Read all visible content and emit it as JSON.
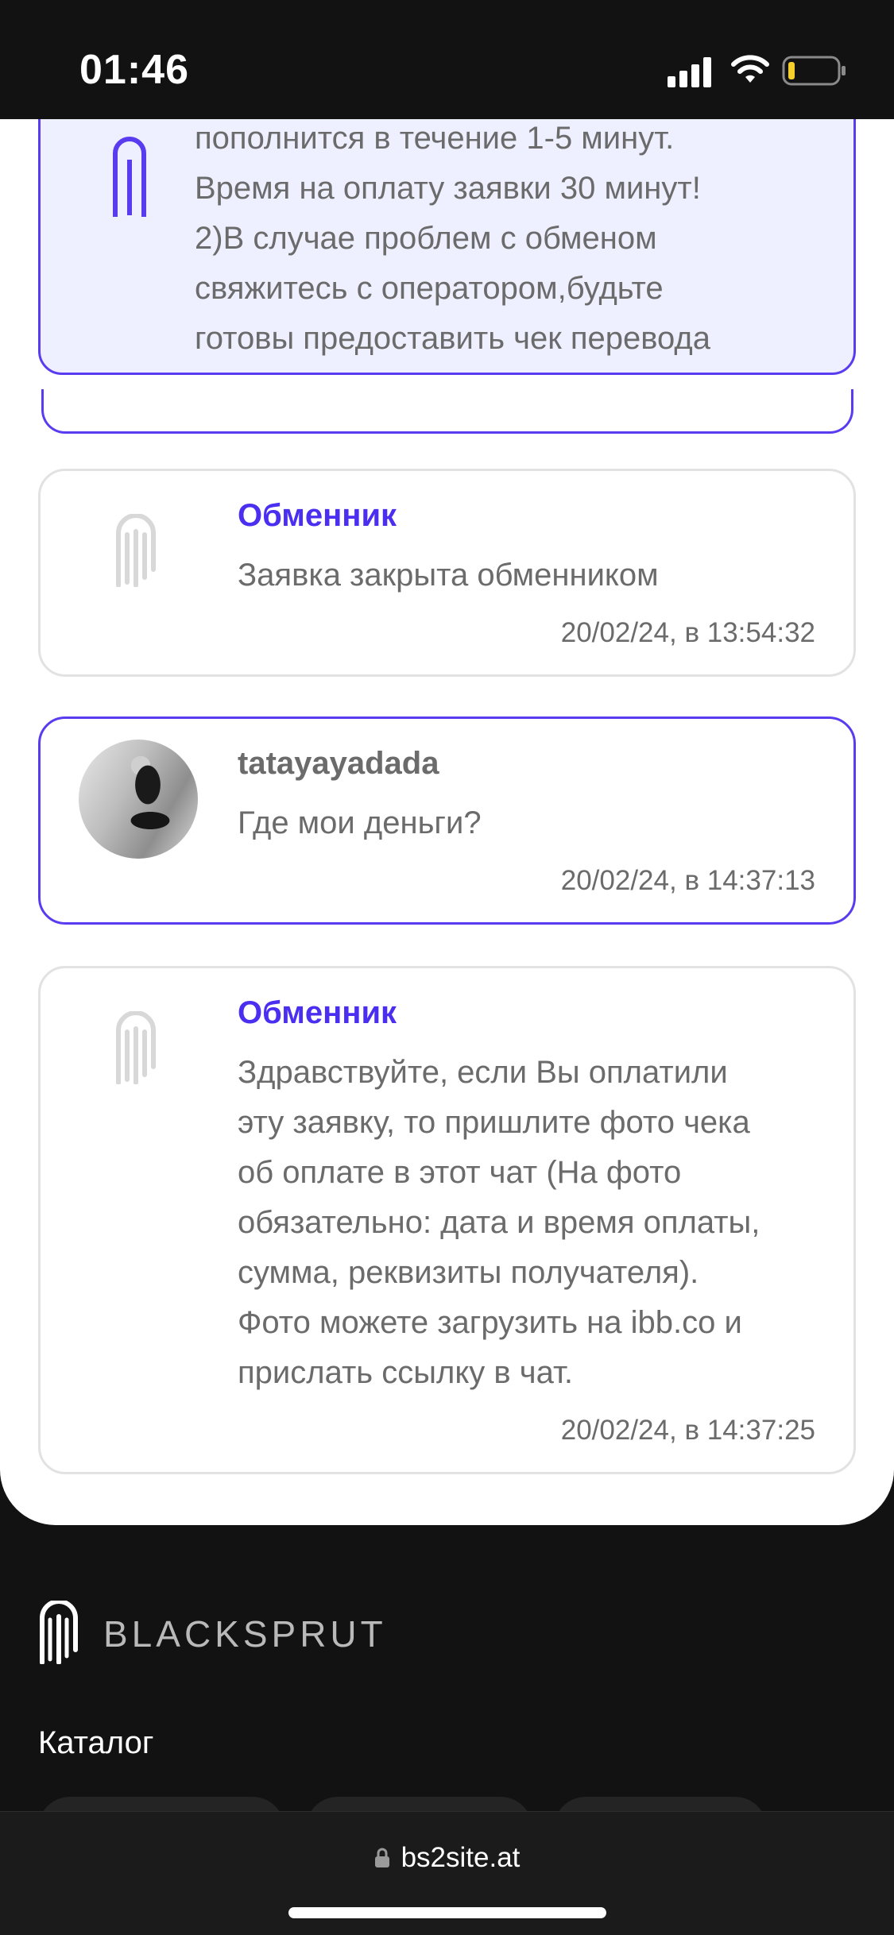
{
  "status_bar": {
    "time": "01:46"
  },
  "notice": {
    "lines": [
      "пополнится в течение 1-5 минут.",
      "Время на оплату заявки 30 минут!",
      "2)В случае проблем с обменом",
      "свяжитесь с оператором,будьте",
      "готовы предоставить чек перевода"
    ]
  },
  "messages": [
    {
      "author": "Обменник",
      "lines": [
        "Заявка закрыта обменником"
      ],
      "time": "20/02/24, в 13:54:32"
    },
    {
      "author": "tatayayadada",
      "lines": [
        "Где мои деньги?"
      ],
      "time": "20/02/24, в 14:37:13"
    },
    {
      "author": "Обменник",
      "lines": [
        "Здравствуйте, если Вы оплатили",
        "эту заявку, то пришлите фото чека",
        "об оплате в этот чат (На фото",
        "обязательно: дата и время оплаты,",
        "сумма, реквизиты получателя).",
        "Фото можете загрузить на ibb.co и",
        "прислать ссылку в чат."
      ],
      "time": "20/02/24, в 14:37:25"
    }
  ],
  "footer": {
    "brand": "BLACKSPRUT",
    "catalog_heading": "Каталог"
  },
  "browser": {
    "url": "bs2site.at"
  },
  "colors": {
    "accent": "#4a2ff0",
    "border_accent": "#5a3cf0",
    "notice_bg": "#eeefff",
    "page_bg": "#ffffff",
    "footer_bg": "#121212"
  }
}
